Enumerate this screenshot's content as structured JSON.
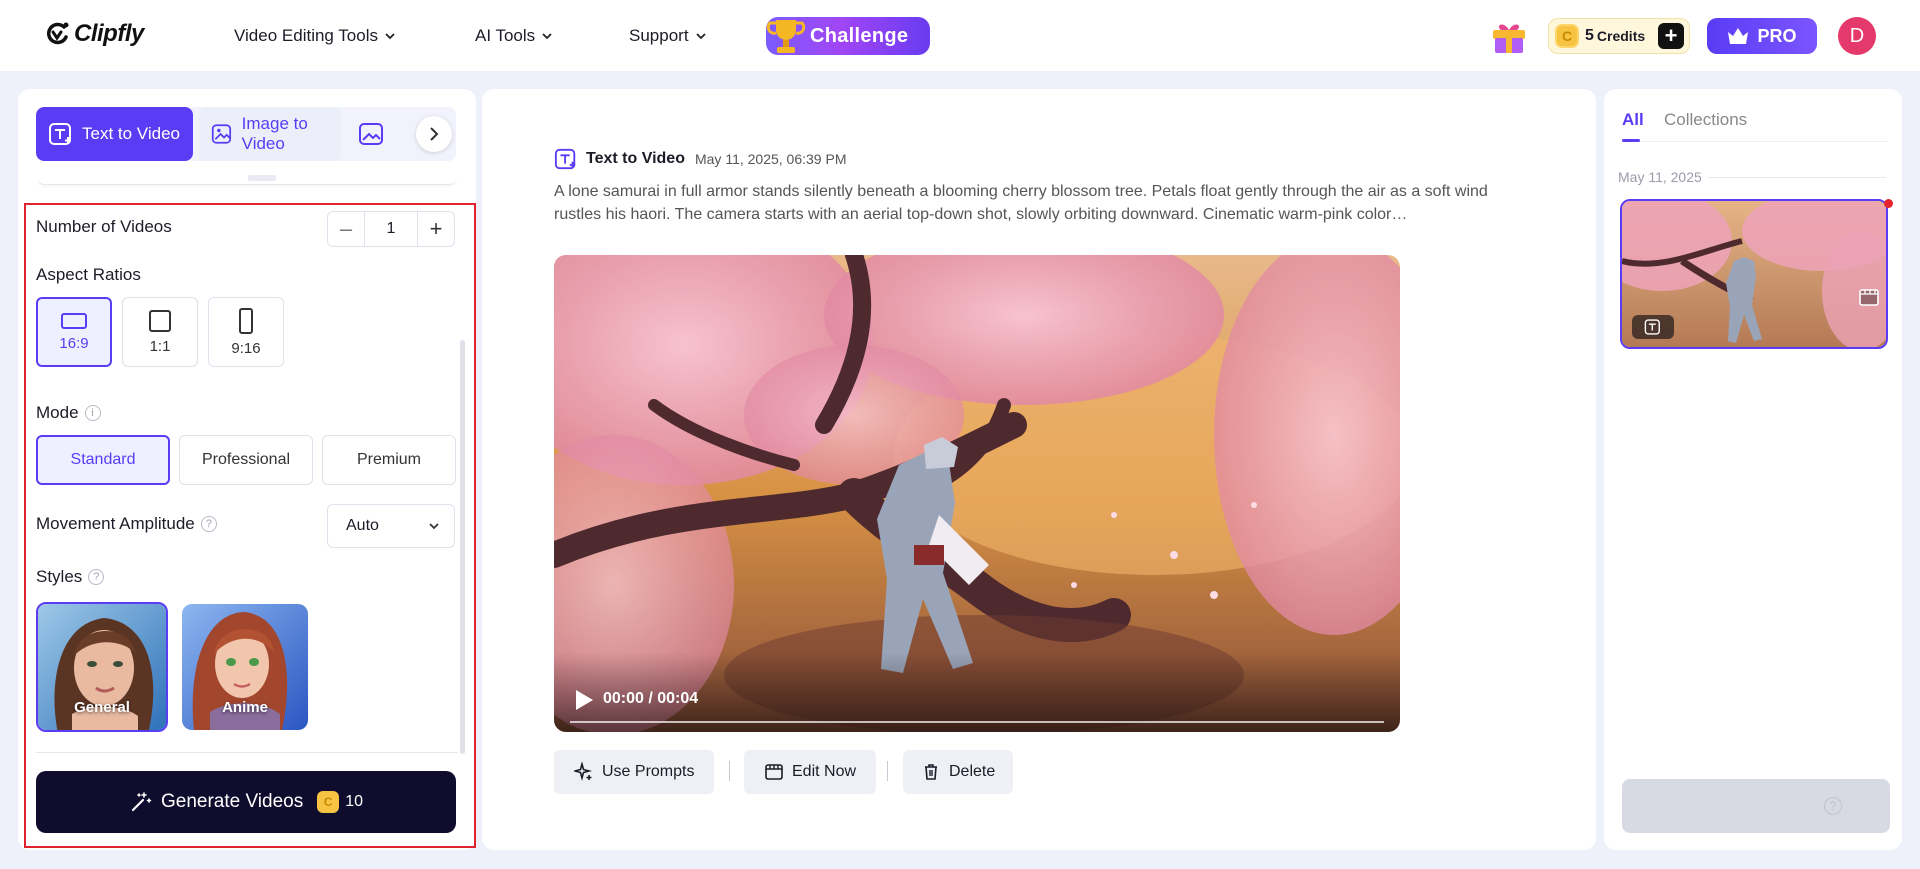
{
  "header": {
    "logo": "Clipfly",
    "nav": [
      {
        "label": "Video Editing Tools"
      },
      {
        "label": "AI Tools"
      },
      {
        "label": "Support"
      }
    ],
    "challenge_label": "Challenge",
    "credits_count": "5",
    "credits_label": "Credits",
    "pro_label": "PRO",
    "avatar_letter": "D"
  },
  "left": {
    "mode_tabs": [
      {
        "label": "Text to Video",
        "active": true
      },
      {
        "label": "Image to Video",
        "active": false
      }
    ],
    "number_of_videos_label": "Number of Videos",
    "number_of_videos_value": "1",
    "aspect_ratios_label": "Aspect Ratios",
    "aspect_ratios": [
      {
        "label": "16:9",
        "active": true
      },
      {
        "label": "1:1",
        "active": false
      },
      {
        "label": "9:16",
        "active": false
      }
    ],
    "mode_label": "Mode",
    "modes": [
      {
        "label": "Standard",
        "active": true
      },
      {
        "label": "Professional",
        "active": false
      },
      {
        "label": "Premium",
        "active": false
      }
    ],
    "movement_label": "Movement Amplitude",
    "movement_value": "Auto",
    "styles_label": "Styles",
    "styles": [
      {
        "label": "General",
        "active": true
      },
      {
        "label": "Anime",
        "active": false
      }
    ],
    "generate_label": "Generate Videos",
    "generate_cost": "10"
  },
  "center": {
    "task_type": "Text to Video",
    "task_date": "May 11, 2025, 06:39 PM",
    "prompt": "A lone samurai in full armor stands silently beneath a blooming cherry blossom tree. Petals float gently through the air as a soft wind rustles his haori. The camera starts with an aerial top-down shot, slowly orbiting downward. Cinematic warm-pink color…",
    "video_time": "00:00 / 00:04",
    "actions": [
      {
        "label": "Use Prompts"
      },
      {
        "label": "Edit Now"
      },
      {
        "label": "Delete"
      }
    ]
  },
  "right": {
    "tabs": [
      {
        "label": "All",
        "active": true
      },
      {
        "label": "Collections",
        "active": false
      }
    ],
    "group_date": "May 11, 2025"
  },
  "colors": {
    "accent": "#5a3cf5",
    "highlight_box": "#e0242f",
    "generate_bg": "#0f0c2e"
  }
}
